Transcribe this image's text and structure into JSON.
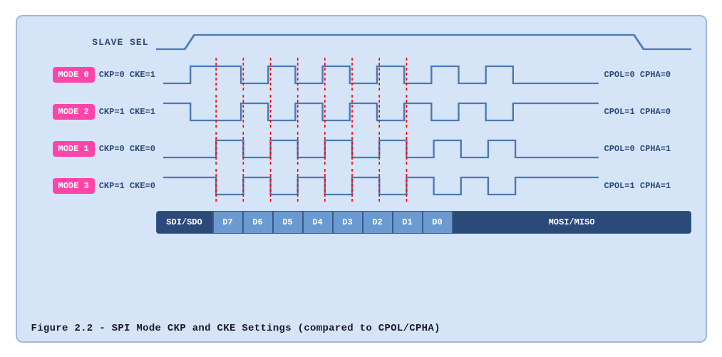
{
  "title": "Figure 2.2 - SPI Mode CKP and CKE Settings (compared to CPOL/CPHA)",
  "slave_label": "SLAVE SEL",
  "modes": [
    {
      "badge": "MODE 0",
      "ckp": "CKP=0 CKE=1",
      "cpol": "CPOL=0 CPHA=0",
      "type": "high_idle"
    },
    {
      "badge": "MODE 2",
      "ckp": "CKP=1 CKE=1",
      "cpol": "CPOL=1 CPHA=0",
      "type": "low_idle"
    },
    {
      "badge": "MODE 1",
      "ckp": "CKP=0 CKE=0",
      "cpol": "CPOL=0 CPHA=1",
      "type": "high_idle_phase"
    },
    {
      "badge": "MODE 3",
      "ckp": "CKP=1 CKE=0",
      "cpol": "CPOL=1 CPHA=1",
      "type": "low_idle_phase"
    }
  ],
  "data_segments": [
    {
      "label": "SDI/SDO",
      "type": "dark",
      "width": 80
    },
    {
      "label": "D7",
      "type": "light",
      "width": 42
    },
    {
      "label": "D6",
      "type": "light",
      "width": 42
    },
    {
      "label": "D5",
      "type": "light",
      "width": 42
    },
    {
      "label": "D4",
      "type": "light",
      "width": 42
    },
    {
      "label": "D3",
      "type": "light",
      "width": 42
    },
    {
      "label": "D2",
      "type": "light",
      "width": 42
    },
    {
      "label": "D1",
      "type": "light",
      "width": 42
    },
    {
      "label": "D0",
      "type": "light",
      "width": 42
    },
    {
      "label": "MOSI/MISO",
      "type": "dark",
      "width": 100
    }
  ],
  "figure_caption": "Figure 2.2 - SPI Mode CKP and CKE Settings (compared to CPOL/CPHA)"
}
